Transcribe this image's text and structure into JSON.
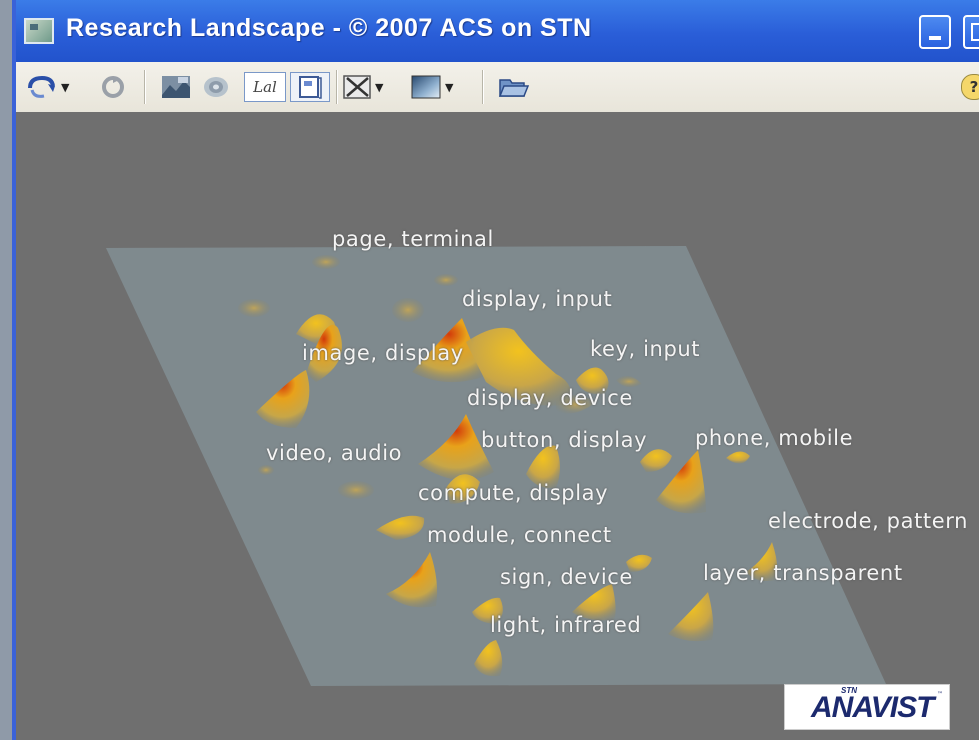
{
  "window": {
    "title": "Research Landscape - © 2007 ACS on STN"
  },
  "toolbar": {
    "buttons": [
      {
        "name": "rotate-icon",
        "dropdown": true
      },
      {
        "name": "reset-view-icon",
        "dropdown": false
      },
      {
        "name": "landscape-view-icon",
        "dropdown": false
      },
      {
        "name": "contour-view-icon",
        "dropdown": false
      },
      {
        "name": "labels-icon",
        "dropdown": false
      },
      {
        "name": "label-list-icon",
        "dropdown": false
      },
      {
        "name": "clear-selection-icon",
        "dropdown": true
      },
      {
        "name": "color-scheme-icon",
        "dropdown": true
      },
      {
        "name": "open-folder-icon",
        "dropdown": false
      }
    ],
    "labels_text": "Lal",
    "help_label": "?"
  },
  "landscape": {
    "labels": [
      "page, terminal",
      "display, input",
      "image, display",
      "key, input",
      "display, device",
      "button, display",
      "phone, mobile",
      "video, audio",
      "compute, display",
      "electrode, pattern",
      "module, connect",
      "layer, transparent",
      "sign, device",
      "light, infrared"
    ]
  },
  "logo": {
    "super": "STN",
    "text": "ANAVIST",
    "tm": "™"
  }
}
